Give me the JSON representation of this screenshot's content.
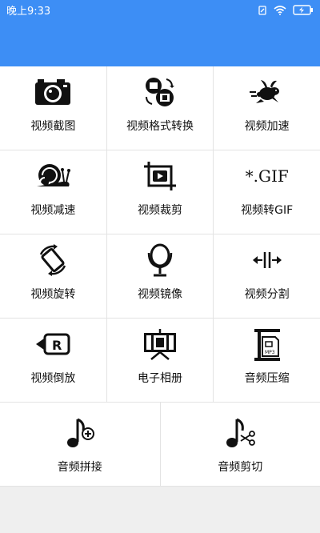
{
  "status": {
    "time": "晚上9:33",
    "battery_icon": "battery-charging-icon",
    "wifi_icon": "wifi-icon",
    "sim_icon": "sim-icon"
  },
  "theme": {
    "primary": "#3d8ef5"
  },
  "tools": [
    {
      "label": "视频截图",
      "icon": "camera-icon"
    },
    {
      "label": "视频格式转换",
      "icon": "format-convert-icon"
    },
    {
      "label": "视频加速",
      "icon": "rabbit-icon"
    },
    {
      "label": "视频减速",
      "icon": "snail-icon"
    },
    {
      "label": "视频裁剪",
      "icon": "video-crop-icon"
    },
    {
      "label": "视频转GIF",
      "icon": "gif-icon",
      "icon_text": "*.GIF"
    },
    {
      "label": "视频旋转",
      "icon": "rotate-icon"
    },
    {
      "label": "视频镜像",
      "icon": "mirror-icon"
    },
    {
      "label": "视频分割",
      "icon": "split-icon"
    },
    {
      "label": "视频倒放",
      "icon": "reverse-icon"
    },
    {
      "label": "电子相册",
      "icon": "photo-album-icon"
    },
    {
      "label": "音频压缩",
      "icon": "audio-compress-icon"
    },
    {
      "label": "音频拼接",
      "icon": "audio-join-icon"
    },
    {
      "label": "音频剪切",
      "icon": "audio-cut-icon"
    }
  ]
}
